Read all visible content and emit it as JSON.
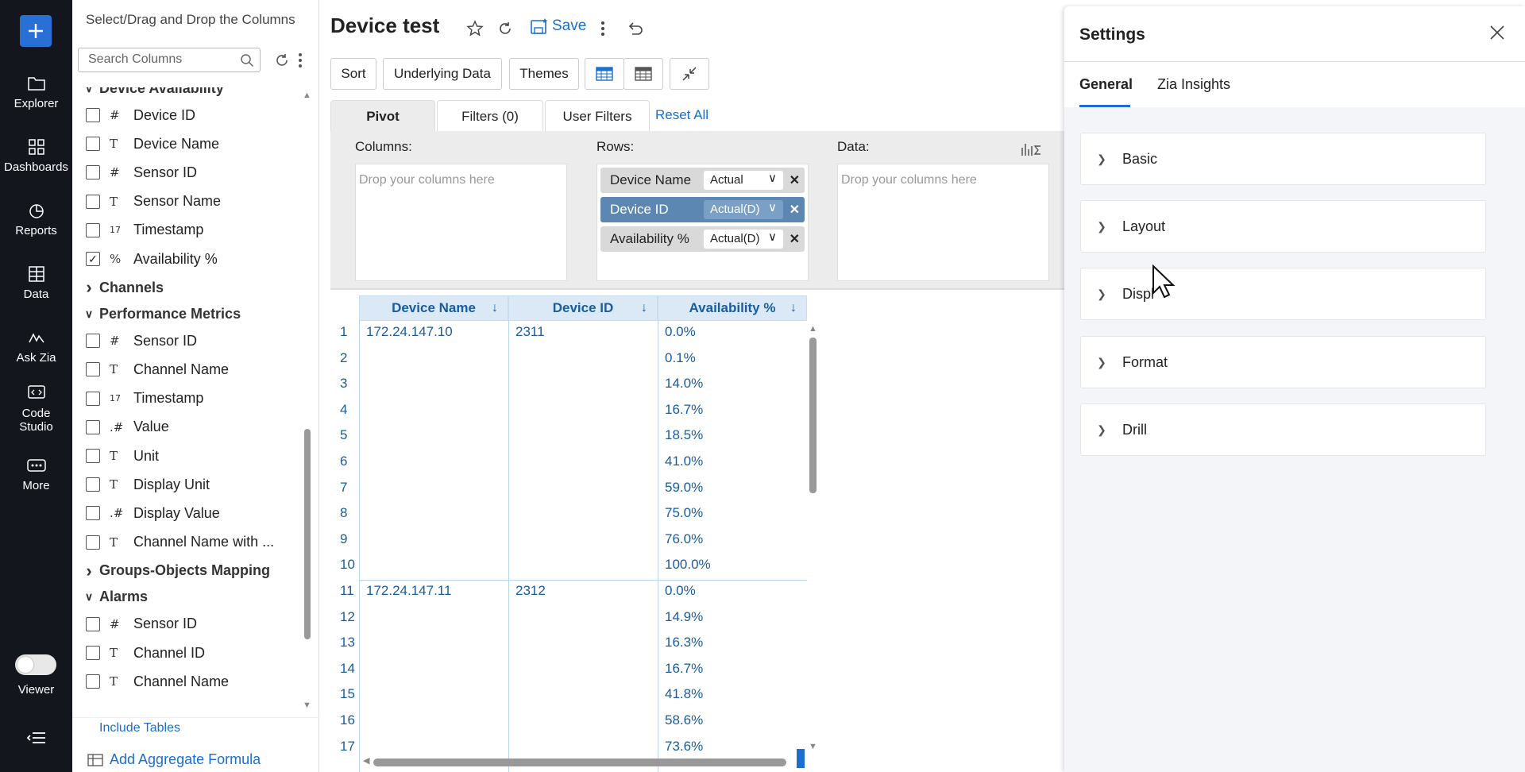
{
  "nav": {
    "items": [
      {
        "label": "Explorer",
        "icon": "folder-icon"
      },
      {
        "label": "Dashboards",
        "icon": "dashboards-icon"
      },
      {
        "label": "Reports",
        "icon": "reports-icon"
      },
      {
        "label": "Data",
        "icon": "data-table-icon"
      },
      {
        "label": "Ask Zia",
        "icon": "ask-zia-icon"
      },
      {
        "label": "Code Studio",
        "icon": "code-studio-icon"
      },
      {
        "label": "More",
        "icon": "more-icon"
      }
    ],
    "viewer_label": "Viewer"
  },
  "columns_panel": {
    "title": "Select/Drag and Drop the Columns",
    "search_placeholder": "Search Columns",
    "groups": [
      {
        "name": "Device Availability",
        "expanded": true,
        "items": [
          {
            "type": "#",
            "label": "Device ID",
            "checked": false
          },
          {
            "type": "T",
            "label": "Device Name",
            "checked": false
          },
          {
            "type": "#",
            "label": "Sensor ID",
            "checked": false
          },
          {
            "type": "T",
            "label": "Sensor Name",
            "checked": false
          },
          {
            "type": "17",
            "label": "Timestamp",
            "checked": false
          },
          {
            "type": "%",
            "label": "Availability %",
            "checked": true
          }
        ]
      },
      {
        "name": "Channels",
        "expanded": false,
        "items": []
      },
      {
        "name": "Performance Metrics",
        "expanded": true,
        "items": [
          {
            "type": "#",
            "label": "Sensor ID",
            "checked": false
          },
          {
            "type": "T",
            "label": "Channel Name",
            "checked": false
          },
          {
            "type": "17",
            "label": "Timestamp",
            "checked": false
          },
          {
            "type": ".#",
            "label": "Value",
            "checked": false
          },
          {
            "type": "T",
            "label": "Unit",
            "checked": false
          },
          {
            "type": "T",
            "label": "Display Unit",
            "checked": false
          },
          {
            "type": ".#",
            "label": "Display Value",
            "checked": false
          },
          {
            "type": "T",
            "label": "Channel Name with ...",
            "checked": false
          }
        ]
      },
      {
        "name": "Groups-Objects Mapping",
        "expanded": false,
        "items": []
      },
      {
        "name": "Alarms",
        "expanded": true,
        "items": [
          {
            "type": "#",
            "label": "Sensor ID",
            "checked": false
          },
          {
            "type": "T",
            "label": "Channel ID",
            "checked": false
          },
          {
            "type": "T",
            "label": "Channel Name",
            "checked": false
          }
        ]
      }
    ],
    "include_tables": "Include Tables",
    "add_aggregate": "Add Aggregate Formula"
  },
  "header": {
    "title": "Device test",
    "save_label": "Save"
  },
  "toolbar": {
    "sort": "Sort",
    "underlying_data": "Underlying Data",
    "themes": "Themes"
  },
  "pivot_tabs": {
    "pivot": "Pivot",
    "filters": "Filters  (0)",
    "user_filters": "User Filters",
    "reset_all": "Reset All"
  },
  "zones": {
    "columns_label": "Columns:",
    "rows_label": "Rows:",
    "data_label": "Data:",
    "drop_placeholder": "Drop your columns here",
    "rows": [
      {
        "name": "Device Name",
        "agg": "Actual",
        "style": "grey"
      },
      {
        "name": "Device ID",
        "agg": "Actual(D)",
        "style": "blue"
      },
      {
        "name": "Availability %",
        "agg": "Actual(D)",
        "style": "grey"
      }
    ]
  },
  "grid": {
    "headers": [
      "Device Name",
      "Device ID",
      "Availability %"
    ],
    "groups": [
      {
        "device_name": "172.24.147.10",
        "device_id": "2311",
        "start": 1,
        "values": [
          "0.0%",
          "0.1%",
          "14.0%",
          "16.7%",
          "18.5%",
          "41.0%",
          "59.0%",
          "75.0%",
          "76.0%",
          "100.0%"
        ]
      },
      {
        "device_name": "172.24.147.11",
        "device_id": "2312",
        "start": 11,
        "values": [
          "0.0%",
          "14.9%",
          "16.3%",
          "16.7%",
          "41.8%",
          "58.6%",
          "73.6%"
        ]
      }
    ]
  },
  "settings": {
    "title": "Settings",
    "tabs": [
      "General",
      "Zia Insights"
    ],
    "sections": [
      "Basic",
      "Layout",
      "Displ",
      "Format",
      "Drill"
    ]
  },
  "colors": {
    "nav_bg": "#14161e",
    "accent": "#1a6fd0",
    "chip_blue": "#5b87b2",
    "grid_header": "#dbe9f6"
  }
}
